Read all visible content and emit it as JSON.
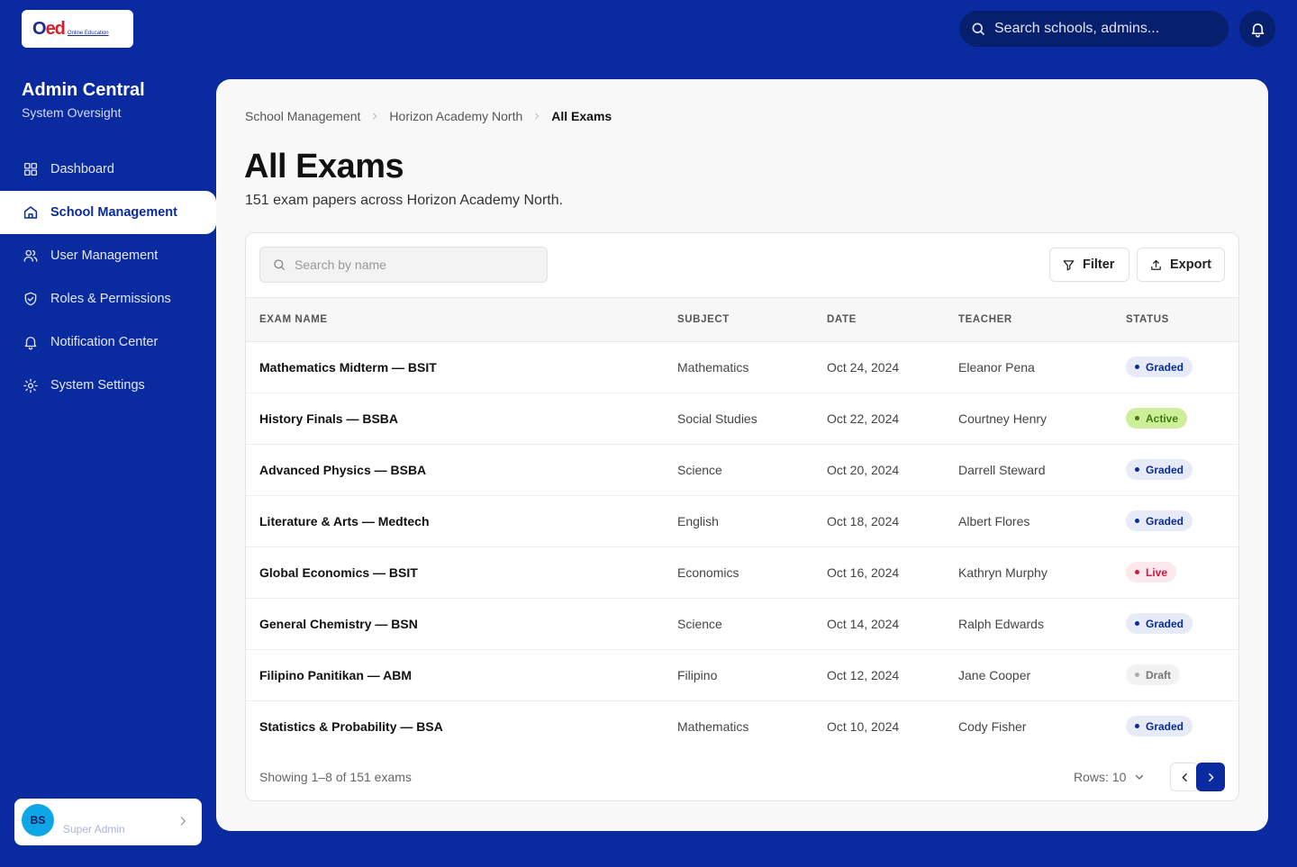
{
  "brand": {
    "logo_o": "O",
    "logo_ed": "ed",
    "logo_tagline": "Online Education"
  },
  "topbar": {
    "search_placeholder": "Search schools, admins..."
  },
  "sidebar": {
    "title": "Admin Central",
    "subtitle": "System Oversight",
    "items": [
      {
        "label": "Dashboard",
        "icon": "grid-icon"
      },
      {
        "label": "School Management",
        "icon": "home-icon"
      },
      {
        "label": "User Management",
        "icon": "users-icon"
      },
      {
        "label": "Roles & Permissions",
        "icon": "shield-check-icon"
      },
      {
        "label": "Notification Center",
        "icon": "bell-icon"
      },
      {
        "label": "System Settings",
        "icon": "gear-icon"
      }
    ],
    "active_index": 1,
    "user": {
      "initials": "BS",
      "role": "Super Admin"
    }
  },
  "breadcrumb": [
    "School Management",
    "Horizon Academy North",
    "All Exams"
  ],
  "page": {
    "title": "All Exams",
    "subtitle": "151 exam papers across Horizon Academy North."
  },
  "table": {
    "search_placeholder": "Search by name",
    "filter_label": "Filter",
    "export_label": "Export",
    "columns": [
      "EXAM NAME",
      "SUBJECT",
      "DATE",
      "TEACHER",
      "STATUS"
    ],
    "rows": [
      {
        "name": "Mathematics Midterm — BSIT",
        "subject": "Mathematics",
        "date": "Oct 24, 2024",
        "teacher": "Eleanor Pena",
        "status": "Graded",
        "status_kind": "graded"
      },
      {
        "name": "History Finals — BSBA",
        "subject": "Social Studies",
        "date": "Oct 22, 2024",
        "teacher": "Courtney Henry",
        "status": "Active",
        "status_kind": "active"
      },
      {
        "name": "Advanced Physics — BSBA",
        "subject": "Science",
        "date": "Oct 20, 2024",
        "teacher": "Darrell Steward",
        "status": "Graded",
        "status_kind": "graded"
      },
      {
        "name": "Literature & Arts — Medtech",
        "subject": "English",
        "date": "Oct 18, 2024",
        "teacher": "Albert Flores",
        "status": "Graded",
        "status_kind": "graded"
      },
      {
        "name": "Global Economics — BSIT",
        "subject": "Economics",
        "date": "Oct 16, 2024",
        "teacher": "Kathryn Murphy",
        "status": "Live",
        "status_kind": "live"
      },
      {
        "name": "General Chemistry — BSN",
        "subject": "Science",
        "date": "Oct 14, 2024",
        "teacher": "Ralph Edwards",
        "status": "Graded",
        "status_kind": "graded"
      },
      {
        "name": "Filipino Panitikan — ABM",
        "subject": "Filipino",
        "date": "Oct 12, 2024",
        "teacher": "Jane Cooper",
        "status": "Draft",
        "status_kind": "draft"
      },
      {
        "name": "Statistics & Probability — BSA",
        "subject": "Mathematics",
        "date": "Oct 10, 2024",
        "teacher": "Cody Fisher",
        "status": "Graded",
        "status_kind": "graded"
      }
    ],
    "footer_info": "Showing 1–8 of 151 exams",
    "rows_per_page": "Rows: 10"
  },
  "colors": {
    "brand_blue": "#0a2aa0",
    "panel": "#f8f8f8"
  }
}
